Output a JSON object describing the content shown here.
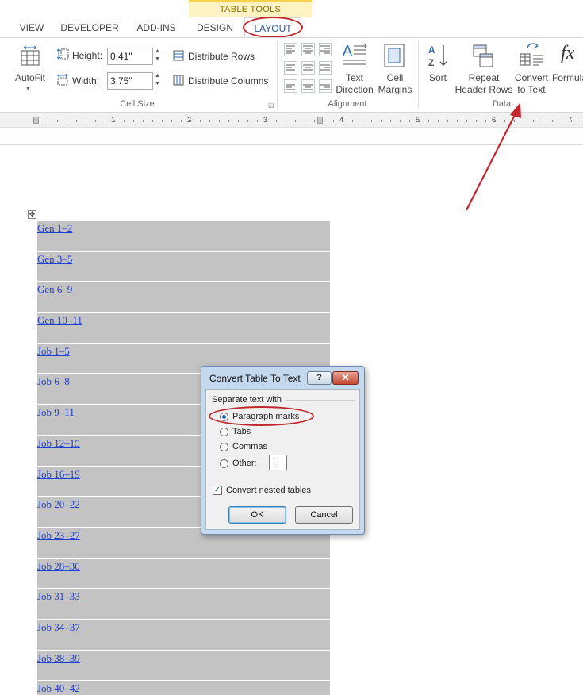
{
  "ribbon": {
    "context_tab": "TABLE TOOLS",
    "tabs": [
      {
        "label": "VIEW"
      },
      {
        "label": "DEVELOPER"
      },
      {
        "label": "ADD-INS"
      },
      {
        "label": "DESIGN"
      },
      {
        "label": "LAYOUT"
      }
    ],
    "cell_size": {
      "autofit": "AutoFit",
      "height_label": "Height:",
      "height_value": "0.41\"",
      "width_label": "Width:",
      "width_value": "3.75\"",
      "distribute_rows": "Distribute Rows",
      "distribute_columns": "Distribute Columns",
      "group_label": "Cell Size"
    },
    "alignment": {
      "text_direction_line1": "Text",
      "text_direction_line2": "Direction",
      "cell_margins_line1": "Cell",
      "cell_margins_line2": "Margins",
      "group_label": "Alignment"
    },
    "data": {
      "sort": "Sort",
      "repeat_line1": "Repeat",
      "repeat_line2": "Header Rows",
      "convert_line1": "Convert",
      "convert_line2": "to Text",
      "formula": "Formula",
      "group_label": "Data"
    }
  },
  "ruler": {
    "numbers": [
      "1",
      "2",
      "3",
      "4",
      "5",
      "6",
      "7"
    ]
  },
  "table": {
    "rows": [
      "Gen 1–2",
      "Gen 3–5",
      "Gen 6–9",
      "Gen 10–11",
      "Job 1–5",
      "Job 6–8",
      "Job 9–11",
      "Job 12–15",
      "Job 16–19",
      "Job 20–22",
      "Job 23–27",
      "Job 28–30",
      "Job 31–33",
      "Job 34–37",
      "Job 38–39",
      "Job 40–42"
    ]
  },
  "dialog": {
    "title": "Convert Table To Text",
    "help": "?",
    "close": "✕",
    "section": "Separate text with",
    "options": [
      "Paragraph marks",
      "Tabs",
      "Commas",
      "Other:"
    ],
    "selected": "Paragraph marks",
    "other_value": ";",
    "nested_label": "Convert nested tables",
    "nested_checked": true,
    "ok": "OK",
    "cancel": "Cancel"
  },
  "colors": {
    "annotation_red": "#c0282d",
    "link_blue": "#1f3fd1",
    "accent_blue": "#2b579a"
  }
}
